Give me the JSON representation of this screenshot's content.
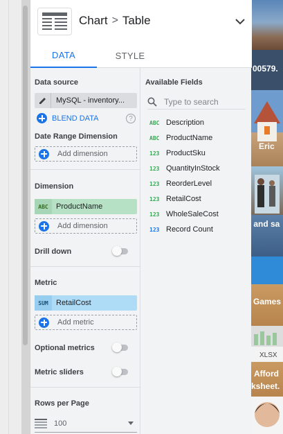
{
  "header": {
    "chart_type": "Chart",
    "separator": ">",
    "component": "Table"
  },
  "tabs": [
    {
      "label": "DATA",
      "active": true
    },
    {
      "label": "STYLE",
      "active": false
    }
  ],
  "data_source": {
    "label": "Data source",
    "name": "MySQL - inventory...",
    "blend_label": "BLEND DATA",
    "help_glyph": "?"
  },
  "date_range": {
    "label": "Date Range Dimension",
    "add_label": "Add dimension"
  },
  "dimension": {
    "label": "Dimension",
    "chip_type": "ABC",
    "chip_name": "ProductName",
    "add_label": "Add dimension"
  },
  "drill_down": {
    "label": "Drill down",
    "on": false
  },
  "metric": {
    "label": "Metric",
    "chip_type": "SUM",
    "chip_name": "RetailCost",
    "add_label": "Add metric"
  },
  "optional_metrics": {
    "label": "Optional metrics",
    "on": false
  },
  "metric_sliders": {
    "label": "Metric sliders",
    "on": false
  },
  "rows_per_page": {
    "label": "Rows per Page",
    "value": "100"
  },
  "available_fields": {
    "title": "Available Fields",
    "search_placeholder": "Type to search",
    "fields": [
      {
        "type": "ABC",
        "name": "Description"
      },
      {
        "type": "ABC",
        "name": "ProductName"
      },
      {
        "type": "123",
        "name": "ProductSku"
      },
      {
        "type": "123",
        "name": "QuantityInStock"
      },
      {
        "type": "123",
        "name": "ReorderLevel"
      },
      {
        "type": "123",
        "name": "RetailCost"
      },
      {
        "type": "123",
        "name": "WholeSaleCost"
      },
      {
        "type": "123",
        "name": "Record Count"
      }
    ]
  },
  "background_tiles": {
    "t1": "00579.",
    "t2": "Eric",
    "t3": ": and sa",
    "t4": "Games",
    "t5": "XLSX",
    "t6": "Afford",
    "t7": "ksheet."
  },
  "colors": {
    "accent": "#1a73e8",
    "dimension_chip": "#b7e1c5",
    "metric_chip": "#aedbf6",
    "dimension_type_text": "#33691e",
    "metric_type_text": "#1a4f7a",
    "field_type_text": "#34a853",
    "metric_field_type_text": "#1a73e8"
  },
  "icons": {
    "chart": "table-chart-icon",
    "collapse": "chevron-down-icon",
    "edit": "pencil-icon",
    "blend": "plus-circle-icon",
    "help": "help-circle-icon",
    "add": "plus-circle-icon",
    "search": "search-icon",
    "rows": "rows-list-icon",
    "dropdown": "caret-down-icon"
  }
}
